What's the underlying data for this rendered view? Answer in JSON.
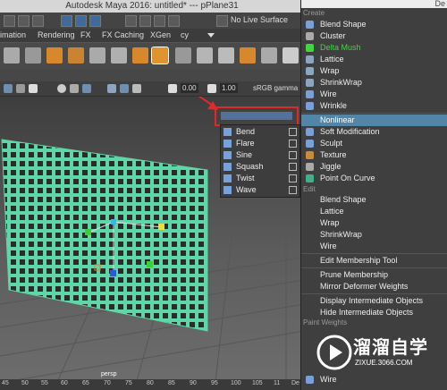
{
  "window": {
    "title": "Autodesk Maya 2016: untitled*   ---   pPlane31"
  },
  "statusline": {
    "live_surface": "No Live Surface"
  },
  "shelf_tabs": [
    "imation",
    "Rendering",
    "FX",
    "FX Caching",
    "XGen",
    "cy"
  ],
  "viewport_toolbar": {
    "field1": "0.00",
    "field2": "1.00",
    "colorspace": "sRGB gamma"
  },
  "viewport": {
    "camera": "persp"
  },
  "ruler": [
    "45",
    "50",
    "55",
    "60",
    "65",
    "70",
    "75",
    "80",
    "85",
    "90",
    "95",
    "100",
    "105",
    "11",
    "De"
  ],
  "submenu": {
    "items": [
      {
        "label": "Bend",
        "icon": "bend-icon"
      },
      {
        "label": "Flare",
        "icon": "flare-icon"
      },
      {
        "label": "Sine",
        "icon": "sine-icon"
      },
      {
        "label": "Squash",
        "icon": "squash-icon"
      },
      {
        "label": "Twist",
        "icon": "twist-icon"
      },
      {
        "label": "Wave",
        "icon": "wave-icon"
      }
    ]
  },
  "menu": {
    "header": "De",
    "sections": {
      "create": "Create",
      "edit": "Edit",
      "paint_weights": "Paint Weights"
    },
    "create_items": [
      "Blend Shape",
      "Cluster",
      "Delta Mush",
      "Lattice",
      "Wrap",
      "ShrinkWrap",
      "Wire",
      "Wrinkle",
      "Nonlinear",
      "Soft Modification",
      "Sculpt",
      "Texture",
      "Jiggle",
      "Point On Curve"
    ],
    "edit_items": [
      "Blend Shape",
      "Lattice",
      "Wrap",
      "ShrinkWrap",
      "Wire"
    ],
    "misc_items": [
      "Edit Membership Tool",
      "Prune Membership",
      "Mirror Deformer Weights",
      "Display Intermediate Objects",
      "Hide Intermediate Objects"
    ],
    "bottom_item": "Wire"
  },
  "watermark": {
    "text": "溜溜自学",
    "url": "ZIXUE.3066.COM"
  },
  "colors": {
    "highlight": "#5285a6",
    "mesh": "#5fd6a8",
    "red_annotation": "#e02a2a",
    "delta_mush": "#3fd63f"
  }
}
